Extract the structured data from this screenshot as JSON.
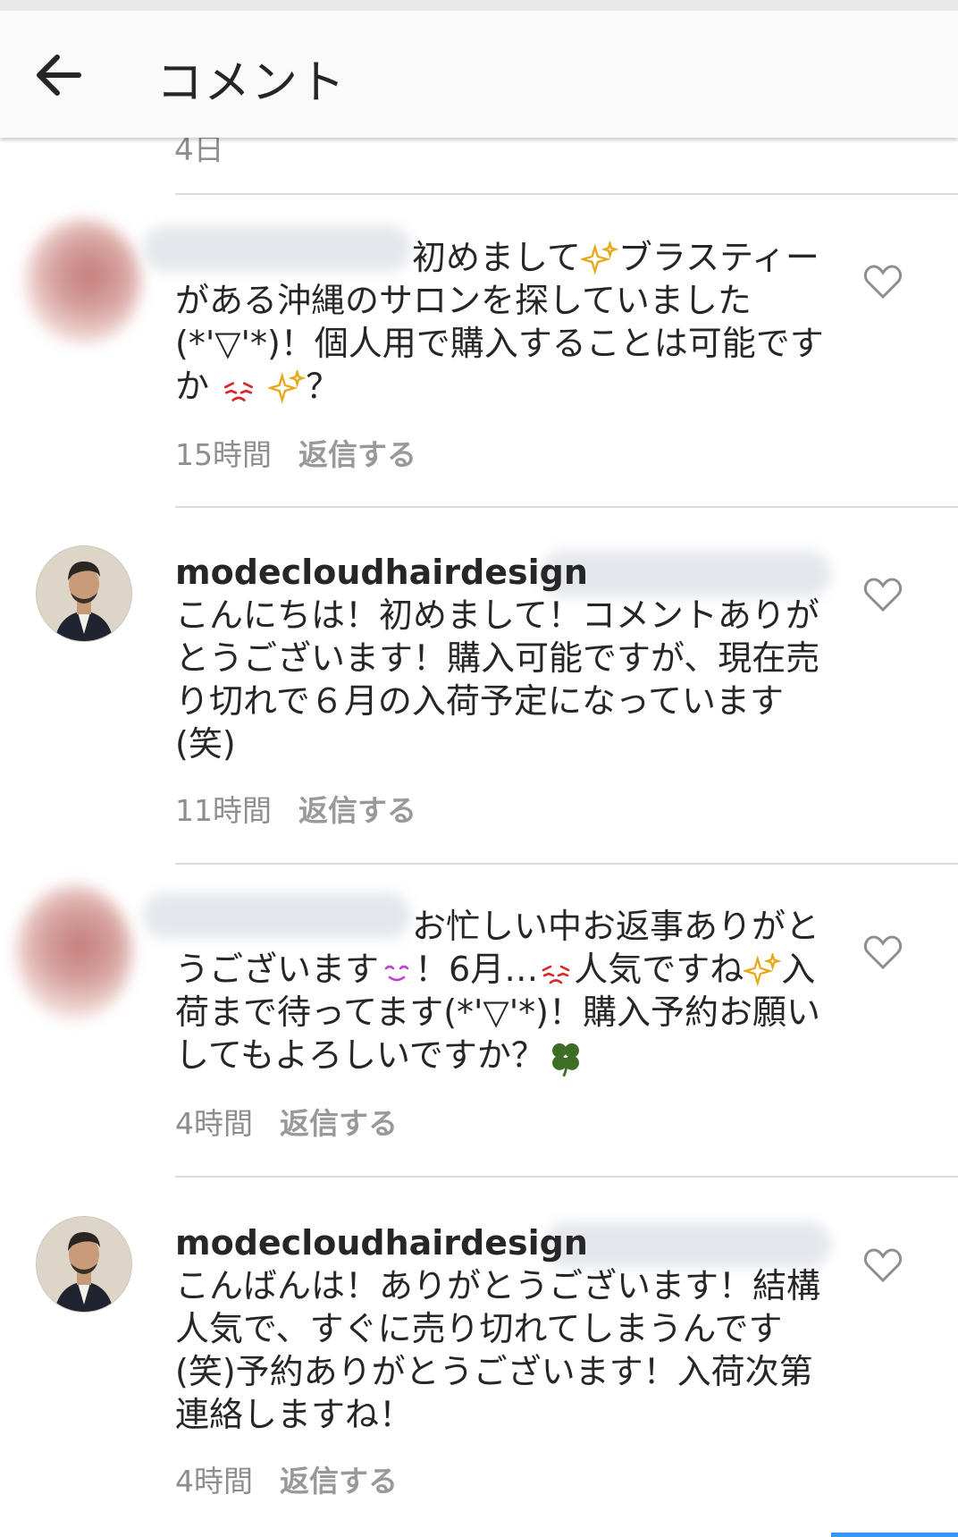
{
  "header": {
    "title": "コメント",
    "back_icon": "arrow-left-icon"
  },
  "top_cut_text": "4日",
  "comments": [
    {
      "user": "",
      "segments": [
        "初めまして",
        "ブラスティーがある沖縄のサロンを探していました(*'▽'*)！個人用で購入することは可能ですか",
        "？"
      ],
      "time": "15時間",
      "reply": "返信する"
    },
    {
      "user": "modecloudhairdesign",
      "text": "こんにちは！初めまして！コメントありがとうございます！購入可能ですが、現在売り切れで６月の入荷予定になっています(笑)",
      "time": "11時間",
      "reply": "返信する"
    },
    {
      "user": "",
      "segments": [
        "お忙しい中お返事ありがとうございます",
        "！6月…",
        "人気ですね",
        "入荷まで待ってます(*'▽'*)！購入予約お願いしてもよろしいですか？"
      ],
      "time": "4時間",
      "reply": "返信する"
    },
    {
      "user": "modecloudhairdesign",
      "text": "こんばんは！ありがとうございます！結構人気で、すぐに売り切れてしまうんです(笑)予約ありがとうございます！入荷次第連絡しますね！",
      "time": "4時間",
      "reply": "返信する"
    }
  ],
  "colors": {
    "accent": "#3897f0",
    "text": "#262626",
    "muted": "#8e8e8e",
    "divider": "#dbdbdb"
  }
}
